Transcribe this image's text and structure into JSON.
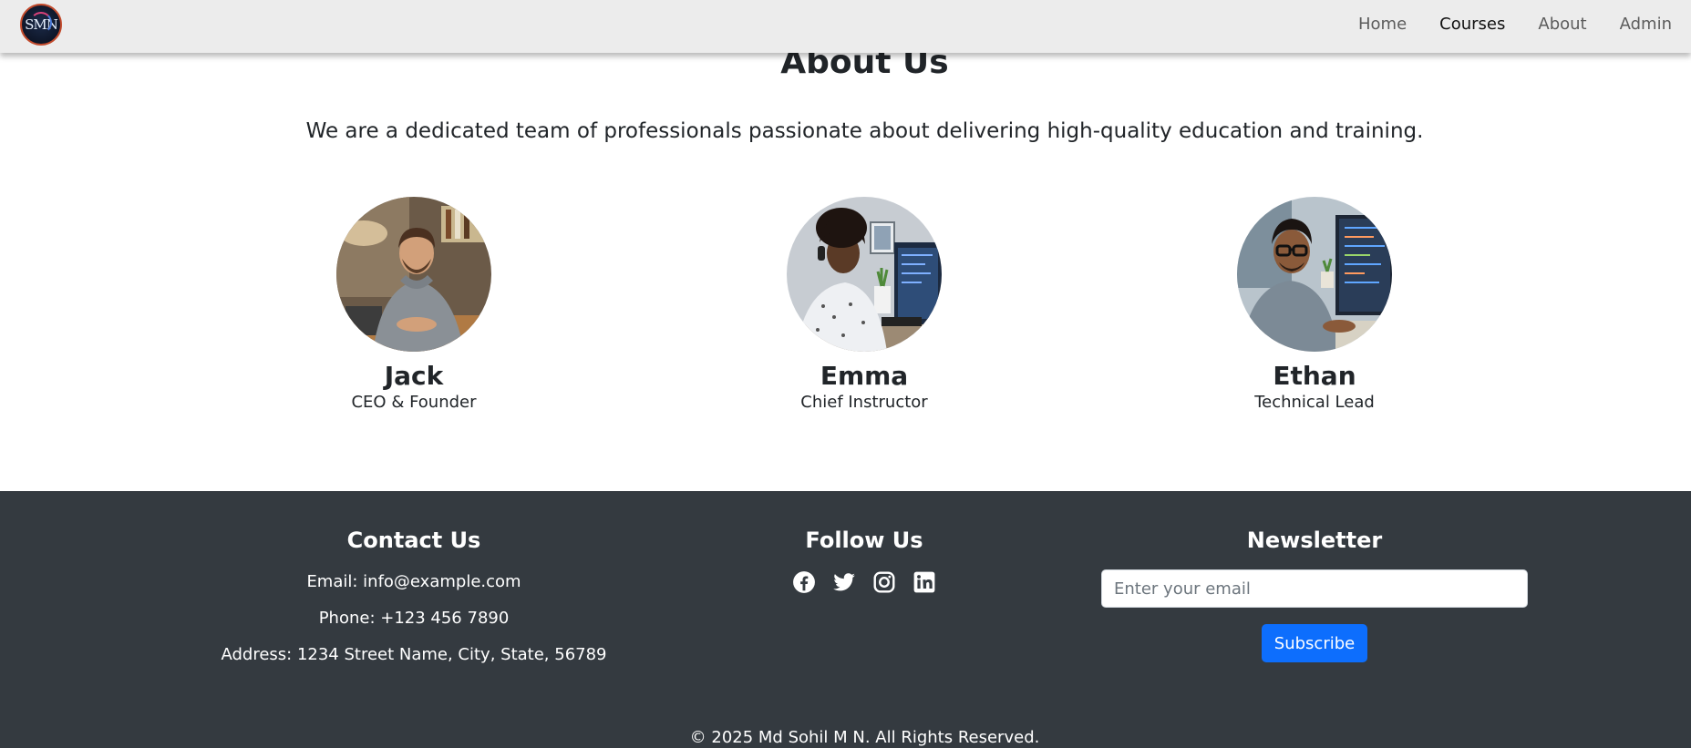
{
  "navbar": {
    "logo_text": "SMN",
    "links": [
      {
        "label": "Home",
        "active": false
      },
      {
        "label": "Courses",
        "active": true
      },
      {
        "label": "About",
        "active": false
      },
      {
        "label": "Admin",
        "active": false
      }
    ]
  },
  "about": {
    "title": "About Us",
    "description": "We are a dedicated team of professionals passionate about delivering high-quality education and training.",
    "team": [
      {
        "name": "Jack",
        "role": "CEO & Founder"
      },
      {
        "name": "Emma",
        "role": "Chief Instructor"
      },
      {
        "name": "Ethan",
        "role": "Technical Lead"
      }
    ]
  },
  "footer": {
    "contact": {
      "heading": "Contact Us",
      "email": "Email: info@example.com",
      "phone": "Phone: +123 456 7890",
      "address": "Address: 1234 Street Name, City, State, 56789"
    },
    "follow": {
      "heading": "Follow Us",
      "icons": [
        "facebook-icon",
        "twitter-icon",
        "instagram-icon",
        "linkedin-icon"
      ]
    },
    "newsletter": {
      "heading": "Newsletter",
      "placeholder": "Enter your email",
      "button_label": "Subscribe"
    },
    "copyright": "© 2025 Md Sohil M N. All Rights Reserved."
  },
  "colors": {
    "navbar_bg": "#ececec",
    "footer_bg": "#343a40",
    "primary": "#0d6efd"
  }
}
